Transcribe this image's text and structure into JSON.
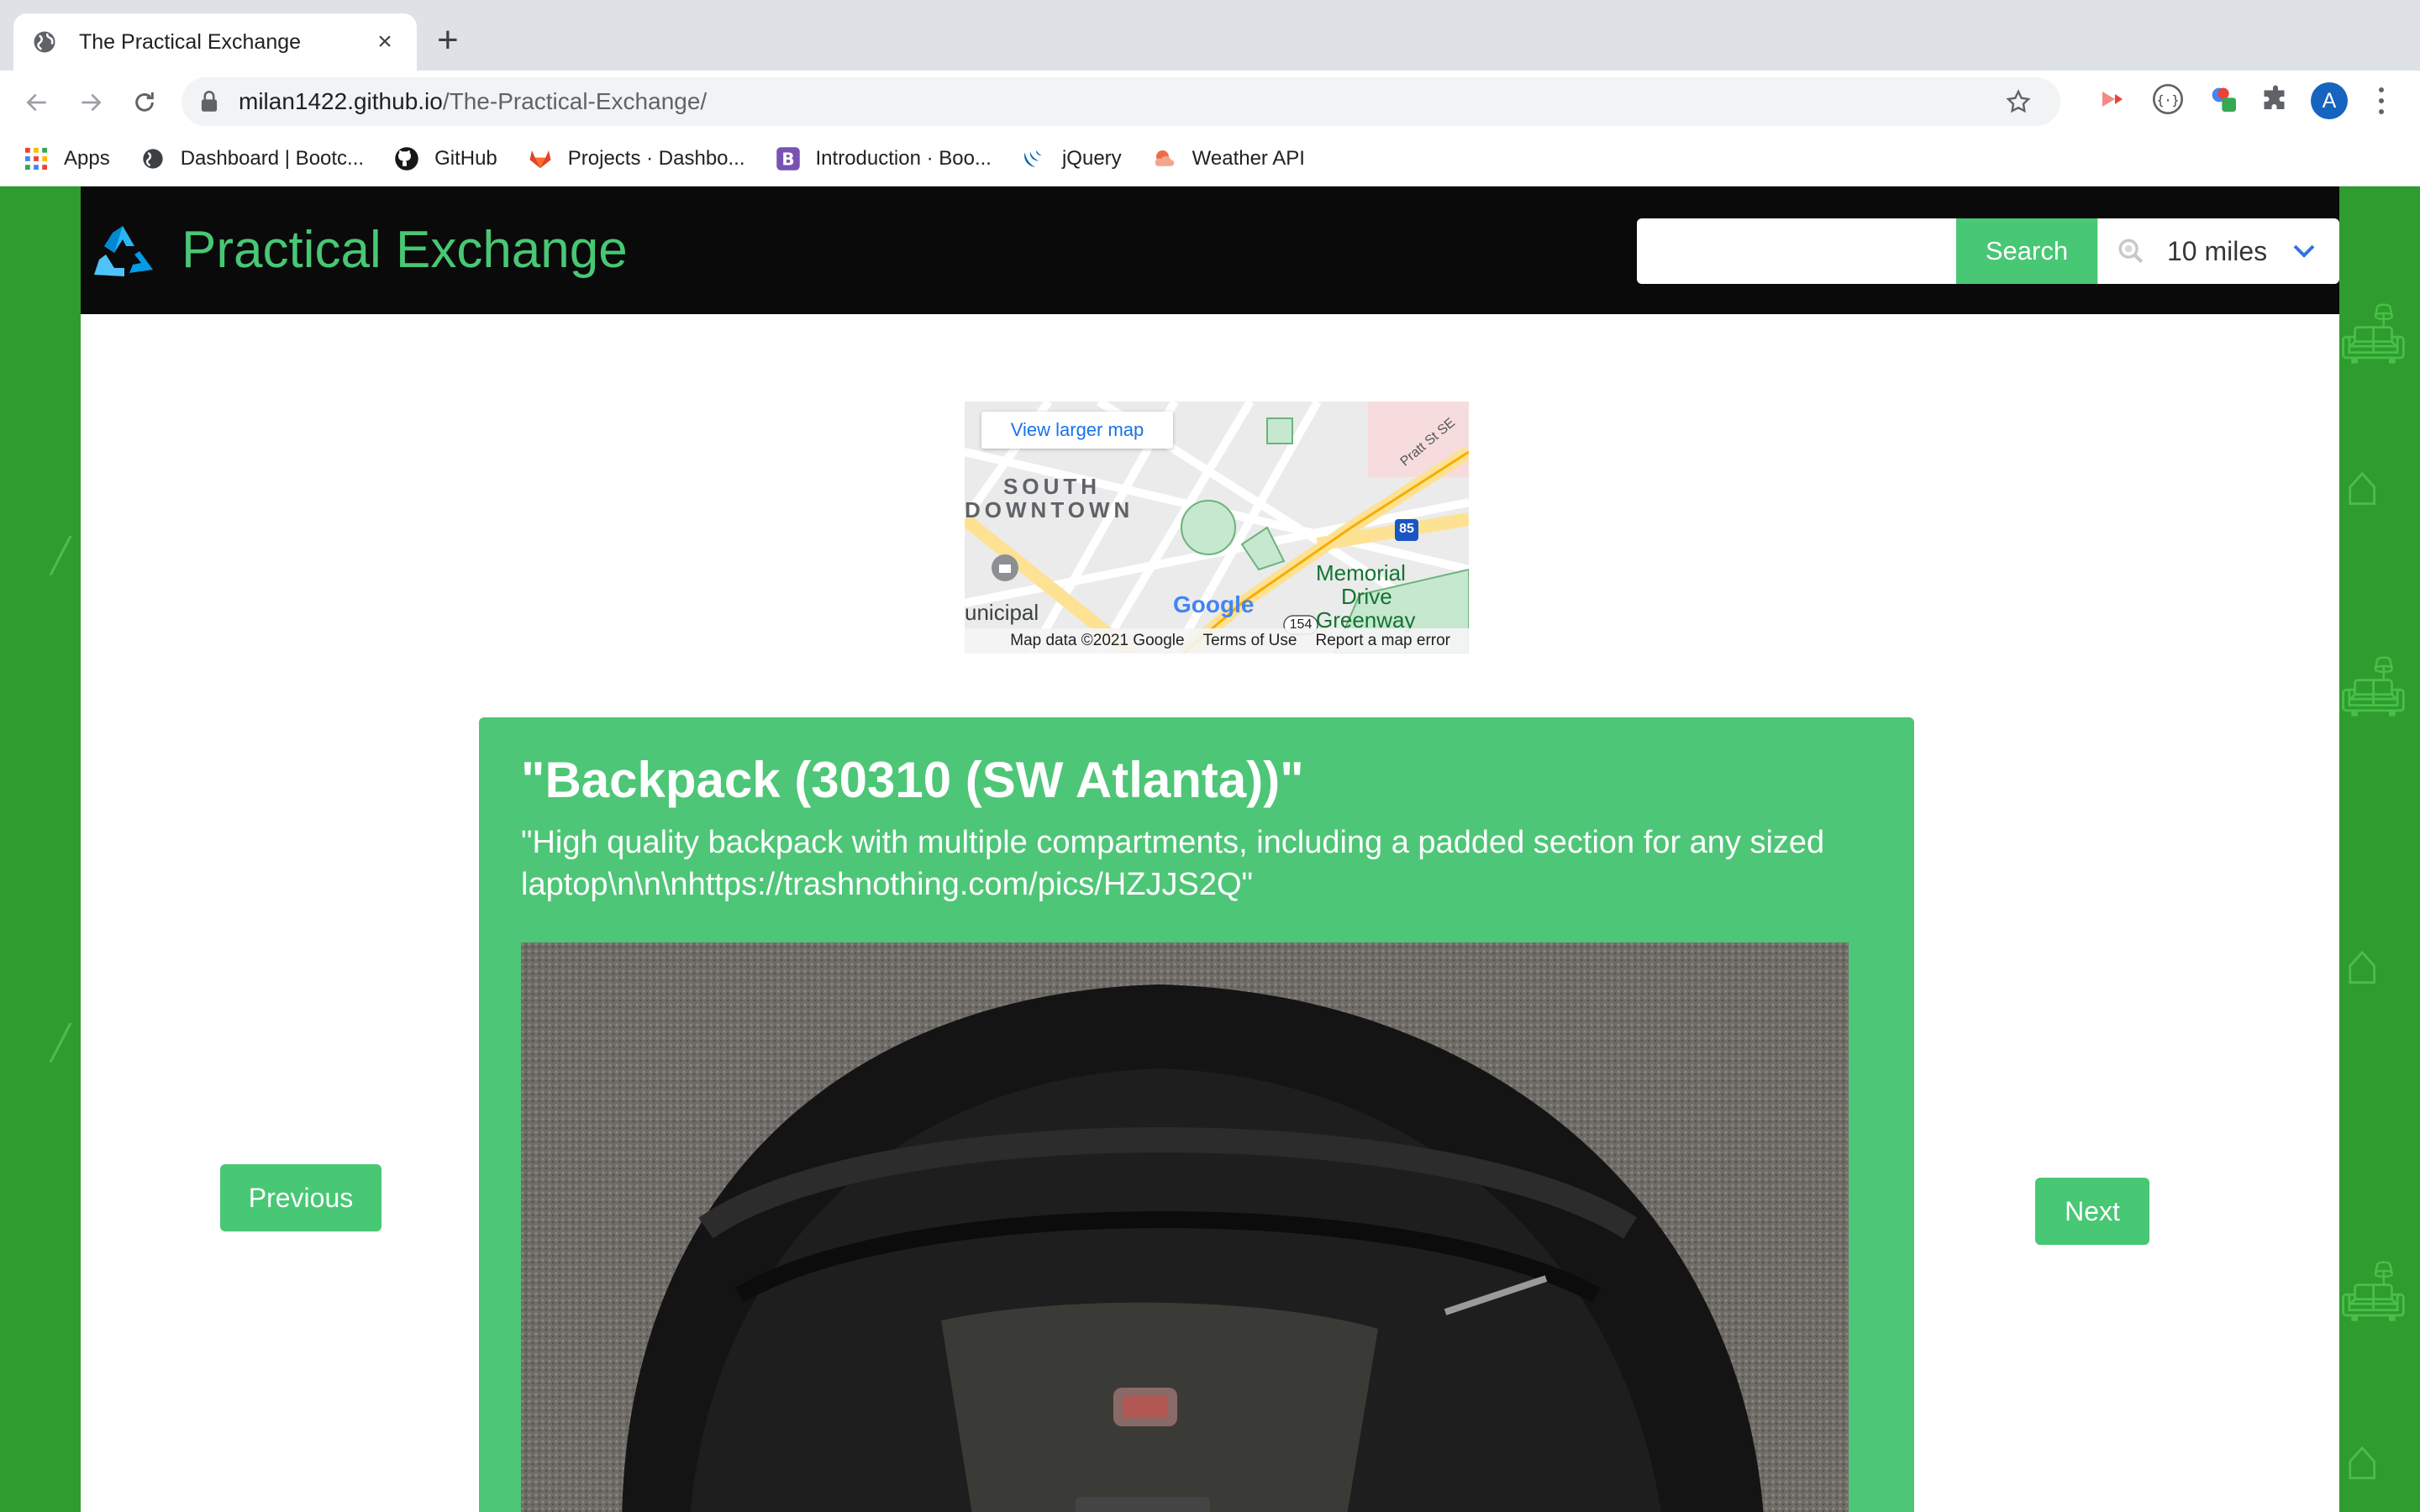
{
  "browser": {
    "tab_title": "The Practical Exchange",
    "tab_close": "×",
    "new_tab": "+",
    "url_host": "milan1422.github.io",
    "url_path": "/The-Practical-Exchange/",
    "avatar_letter": "A",
    "bookmarks": [
      {
        "label": "Apps",
        "icon": "apps-grid-icon"
      },
      {
        "label": "Dashboard | Bootc...",
        "icon": "globe-icon"
      },
      {
        "label": "GitHub",
        "icon": "github-icon"
      },
      {
        "label": "Projects · Dashbo...",
        "icon": "gitlab-icon"
      },
      {
        "label": "Introduction · Boo...",
        "icon": "bootstrap-icon"
      },
      {
        "label": "jQuery",
        "icon": "jquery-icon"
      },
      {
        "label": "Weather API",
        "icon": "weather-icon"
      }
    ]
  },
  "site": {
    "brand": "Practical Exchange",
    "search_button": "Search",
    "search_placeholder": "",
    "radius": "10 miles"
  },
  "map": {
    "view_larger": "View larger map",
    "area_label_1": "SOUTH",
    "area_label_2": "DOWNTOWN",
    "park_label_1": "Memorial",
    "park_label_2": "Drive",
    "park_label_3": "Greenway",
    "municipal_label": "unicipal",
    "street_label": "Pratt St SE",
    "highway_shield": "85",
    "route_shield": "154",
    "google_logo": "Google",
    "footer_data": "Map data ©2021 Google",
    "footer_terms": "Terms of Use",
    "footer_report": "Report a map error"
  },
  "listing": {
    "title": "\"Backpack (30310 (SW Atlanta))\"",
    "description": "\"High quality backpack with multiple compartments, including a padded section for any sized laptop\\n\\n\\nhttps://trashnothing.com/pics/HZJJS2Q\""
  },
  "carousel": {
    "previous": "Previous",
    "next": "Next"
  },
  "colors": {
    "brand_green": "#48c774",
    "card_green": "#4ec677",
    "page_background": "#2e9c2e",
    "header_black": "#0a0a0a"
  }
}
